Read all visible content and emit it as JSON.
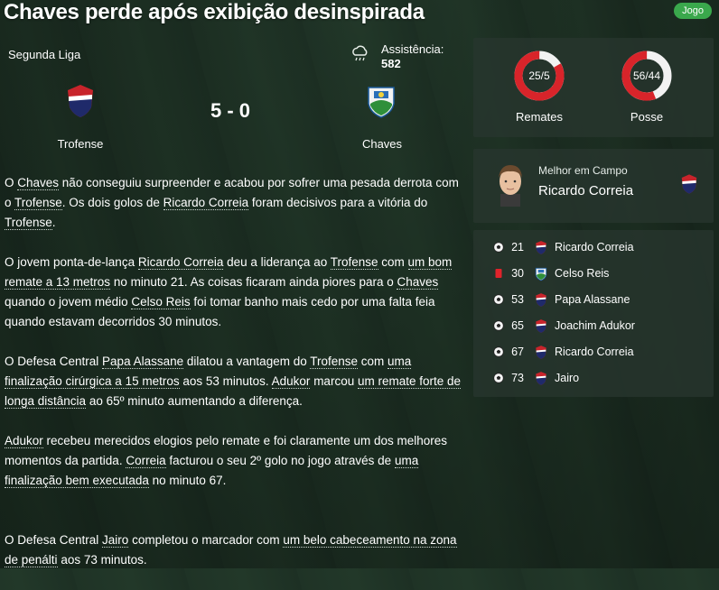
{
  "header": {
    "title": "Chaves perde após exibição desinspirada",
    "badge": "Jogo"
  },
  "match": {
    "league": "Segunda Liga",
    "attendance_label": "Assistência:",
    "attendance": "582",
    "score": "5 - 0",
    "home": "Trofense",
    "away": "Chaves"
  },
  "report": {
    "p1": [
      "O ",
      "Chaves",
      " não conseguiu surpreender e acabou por sofrer uma pesada derrota com o ",
      "Trofense",
      ". Os dois golos de ",
      "Ricardo Correia",
      " foram decisivos para a vitória do ",
      "Trofense",
      "."
    ],
    "p2": [
      "O jovem ponta-de-lança ",
      "Ricardo Correia",
      " deu a liderança ao ",
      "Trofense",
      " com ",
      "um bom remate a 13 metros",
      " no minuto 21. As coisas ficaram ainda piores para o ",
      "Chaves",
      " quando o jovem médio ",
      "Celso Reis",
      " foi tomar banho mais cedo por uma falta feia quando estavam decorridos 30 minutos."
    ],
    "p3": [
      "O Defesa Central ",
      "Papa Alassane",
      " dilatou a vantagem do ",
      "Trofense",
      " com ",
      "uma finalização cirúrgica a 15 metros",
      " aos 53 minutos. ",
      "Adukor",
      " marcou ",
      "um remate forte de longa distância",
      " ao 65º minuto aumentando a diferença."
    ],
    "p4": [
      "Adukor",
      " recebeu merecidos elogios pelo remate e foi claramente um dos melhores momentos da partida. ",
      "Correia",
      " facturou o seu 2º golo no jogo através de ",
      "uma finalização bem executada",
      " no minuto 67."
    ],
    "p5": [
      "O Defesa Central ",
      "Jairo",
      " completou o marcador com ",
      "um belo cabeceamento na zona de penálti",
      " aos 73 minutos."
    ]
  },
  "stats": {
    "shots": {
      "text": "25/5",
      "label": "Remates",
      "home": 25,
      "away": 5
    },
    "possession": {
      "text": "56/44",
      "label": "Posse",
      "home": 56,
      "away": 44
    }
  },
  "motm": {
    "label": "Melhor em Campo",
    "name": "Ricardo Correia"
  },
  "events": [
    {
      "minute": "21",
      "type": "goal",
      "team": "home",
      "player": "Ricardo Correia"
    },
    {
      "minute": "30",
      "type": "red-card",
      "team": "away",
      "player": "Celso Reis"
    },
    {
      "minute": "53",
      "type": "goal",
      "team": "home",
      "player": "Papa Alassane"
    },
    {
      "minute": "65",
      "type": "goal",
      "team": "home",
      "player": "Joachim Adukor"
    },
    {
      "minute": "67",
      "type": "goal",
      "team": "home",
      "player": "Ricardo Correia"
    },
    {
      "minute": "73",
      "type": "goal",
      "team": "home",
      "player": "Jairo"
    }
  ],
  "colors": {
    "home_red": "#c8242b",
    "home_navy": "#1f2a6a",
    "accent_red": "#d8242a",
    "badge_green": "#3aa84c"
  }
}
